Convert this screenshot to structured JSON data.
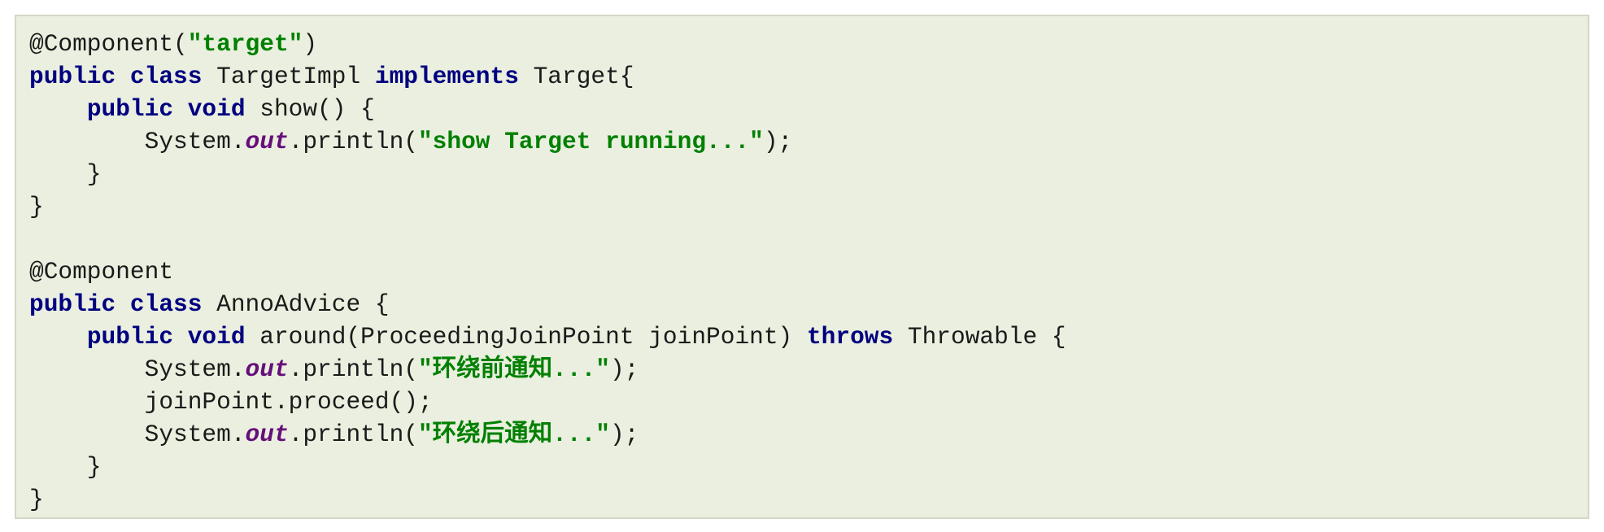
{
  "code": {
    "lines": [
      [
        {
          "t": "@Component(",
          "c": "ann"
        },
        {
          "t": "\"target\"",
          "c": "str"
        },
        {
          "t": ")",
          "c": "plain"
        }
      ],
      [
        {
          "t": "public class",
          "c": "kw"
        },
        {
          "t": " TargetImpl ",
          "c": "plain"
        },
        {
          "t": "implements",
          "c": "kw"
        },
        {
          "t": " Target{",
          "c": "plain"
        }
      ],
      [
        {
          "t": "    ",
          "c": "plain"
        },
        {
          "t": "public void",
          "c": "kw"
        },
        {
          "t": " show() {",
          "c": "plain"
        }
      ],
      [
        {
          "t": "        System.",
          "c": "plain"
        },
        {
          "t": "out",
          "c": "fld"
        },
        {
          "t": ".println(",
          "c": "plain"
        },
        {
          "t": "\"show Target running...\"",
          "c": "str"
        },
        {
          "t": ");",
          "c": "plain"
        }
      ],
      [
        {
          "t": "    }",
          "c": "plain"
        }
      ],
      [
        {
          "t": "}",
          "c": "plain"
        }
      ],
      [
        {
          "t": "",
          "c": "plain"
        }
      ],
      [
        {
          "t": "@Component",
          "c": "ann"
        }
      ],
      [
        {
          "t": "public class",
          "c": "kw"
        },
        {
          "t": " AnnoAdvice {",
          "c": "plain"
        }
      ],
      [
        {
          "t": "    ",
          "c": "plain"
        },
        {
          "t": "public void",
          "c": "kw"
        },
        {
          "t": " around(ProceedingJoinPoint joinPoint) ",
          "c": "plain"
        },
        {
          "t": "throws",
          "c": "kw"
        },
        {
          "t": " Throwable {",
          "c": "plain"
        }
      ],
      [
        {
          "t": "        System.",
          "c": "plain"
        },
        {
          "t": "out",
          "c": "fld"
        },
        {
          "t": ".println(",
          "c": "plain"
        },
        {
          "t": "\"环绕前通知...\"",
          "c": "str"
        },
        {
          "t": ");",
          "c": "plain"
        }
      ],
      [
        {
          "t": "        joinPoint.proceed();",
          "c": "plain"
        }
      ],
      [
        {
          "t": "        System.",
          "c": "plain"
        },
        {
          "t": "out",
          "c": "fld"
        },
        {
          "t": ".println(",
          "c": "plain"
        },
        {
          "t": "\"环绕后通知...\"",
          "c": "str"
        },
        {
          "t": ");",
          "c": "plain"
        }
      ],
      [
        {
          "t": "    }",
          "c": "plain"
        }
      ],
      [
        {
          "t": "}",
          "c": "plain"
        }
      ]
    ]
  },
  "colors": {
    "background": "#eaefdf",
    "keyword": "#000080",
    "string": "#008000",
    "field": "#660e7a",
    "text": "#1a1a1a"
  }
}
